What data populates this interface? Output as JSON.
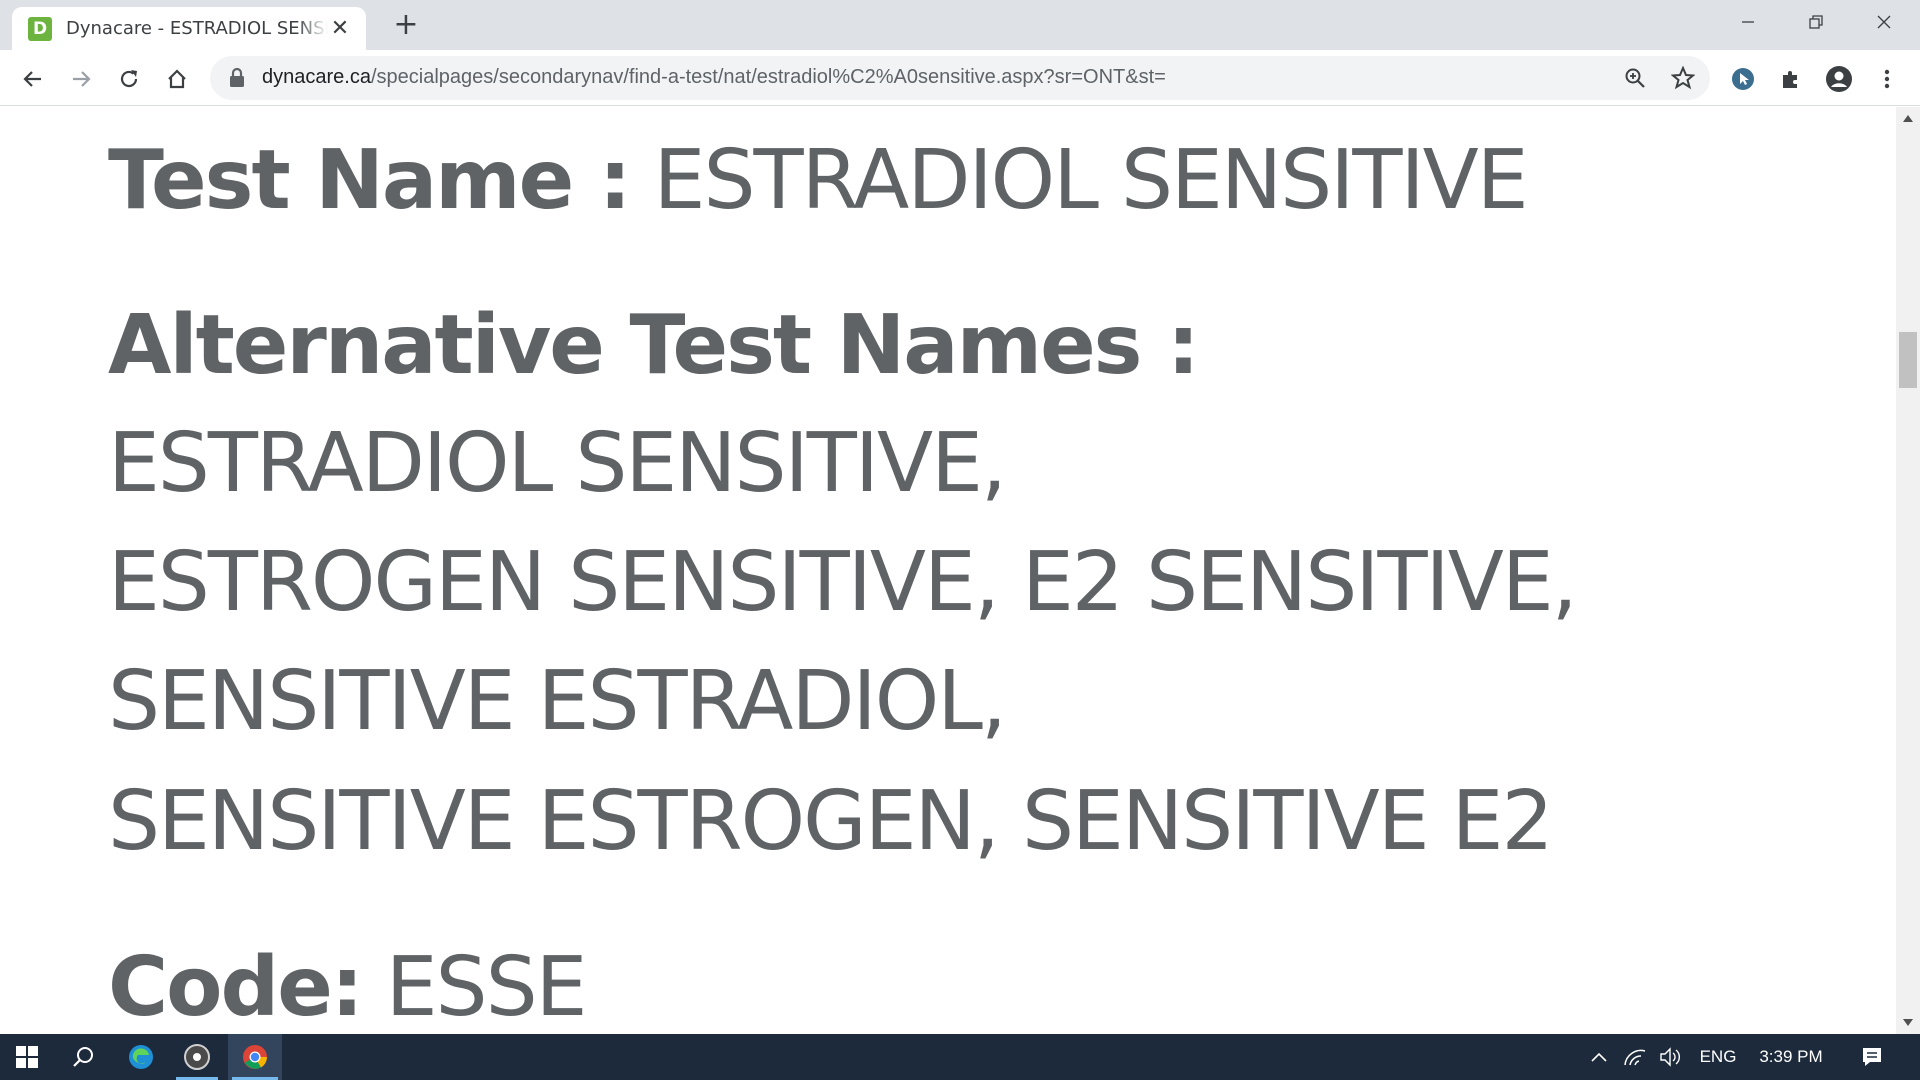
{
  "browser": {
    "tab_title": "Dynacare - ESTRADIOL SENSITIVE",
    "favicon_letter": "D",
    "url_host": "dynacare.ca",
    "url_path": "/specialpages/secondarynav/find-a-test/nat/estradiol%C2%A0sensitive.aspx?sr=ONT&st="
  },
  "page": {
    "test_name_label": "Test Name :",
    "test_name_value": "ESTRADIOL SENSITIVE",
    "alt_names_label": "Alternative Test Names :",
    "alt_names_lines": [
      "ESTRADIOL SENSITIVE,",
      "ESTROGEN SENSITIVE, E2 SENSITIVE,",
      "SENSITIVE ESTRADIOL,",
      "SENSITIVE ESTROGEN, SENSITIVE E2"
    ],
    "code_label": "Code:",
    "code_value": "ESSE"
  },
  "taskbar": {
    "language": "ENG",
    "time": "3:39 PM"
  },
  "colors": {
    "page_text": "#5f6366",
    "favicon": "#6cb33f",
    "taskbar": "#1c2a3c"
  }
}
